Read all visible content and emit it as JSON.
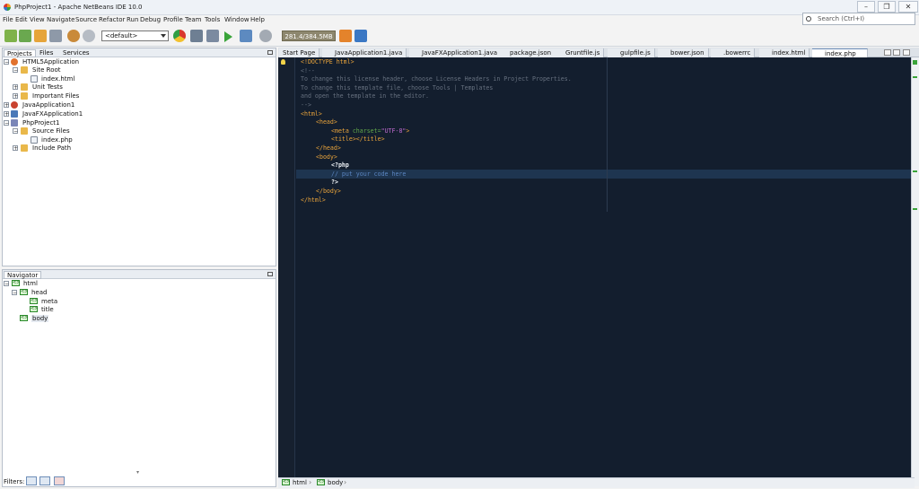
{
  "window": {
    "title": "PhpProject1 - Apache NetBeans IDE 10.0"
  },
  "menu": [
    "File",
    "Edit",
    "View",
    "Navigate",
    "Source",
    "Refactor",
    "Run",
    "Debug",
    "Profile",
    "Team",
    "Tools",
    "Window",
    "Help"
  ],
  "search": {
    "placeholder": "Search (Ctrl+I)"
  },
  "toolbar": {
    "config": "<default>",
    "memory": "281.4/384.5MB"
  },
  "projects_panel": {
    "tabs": [
      "Projects",
      "Files",
      "Services"
    ],
    "tree": [
      {
        "label": "HTML5Application",
        "icon": "html5-project-icon"
      },
      {
        "label": "Site Root",
        "icon": "folder-icon"
      },
      {
        "label": "index.html",
        "icon": "html-file-icon"
      },
      {
        "label": "Unit Tests",
        "icon": "folder-icon"
      },
      {
        "label": "Important Files",
        "icon": "folder-icon"
      },
      {
        "label": "JavaApplication1",
        "icon": "java-project-icon"
      },
      {
        "label": "JavaFXApplication1",
        "icon": "javafx-project-icon"
      },
      {
        "label": "PhpProject1",
        "icon": "php-project-icon"
      },
      {
        "label": "Source Files",
        "icon": "folder-icon"
      },
      {
        "label": "index.php",
        "icon": "php-file-icon"
      },
      {
        "label": "Include Path",
        "icon": "folder-icon"
      }
    ]
  },
  "navigator": {
    "title": "Navigator",
    "tree": [
      "html",
      "head",
      "meta",
      "title",
      "body"
    ],
    "filters_label": "Filters:"
  },
  "editor_tabs": [
    "Start Page",
    "JavaApplication1.java",
    "JavaFXApplication1.java",
    "package.json",
    "Gruntfile.js",
    "gulpfile.js",
    "bower.json",
    ".bowerrc",
    "index.html",
    "index.php"
  ],
  "code": {
    "l1": "<!DOCTYPE html>",
    "l2": "<!--",
    "l3": "To change this license header, choose License Headers in Project Properties.",
    "l4": "To change this template file, choose Tools | Templates",
    "l5": "and open the template in the editor.",
    "l6": "-->",
    "l7": "<html>",
    "l8": "<head>",
    "l9a": "<meta ",
    "l9b": "charset=",
    "l9c": "\"UTF-8\"",
    "l9d": ">",
    "l10": "<title></title>",
    "l11": "</head>",
    "l12": "<body>",
    "l13": "<?php",
    "l14": "// put your code here",
    "l15": "?>",
    "l16": "</body>",
    "l17": "</html>"
  },
  "breadcrumb": [
    "html",
    "body"
  ]
}
